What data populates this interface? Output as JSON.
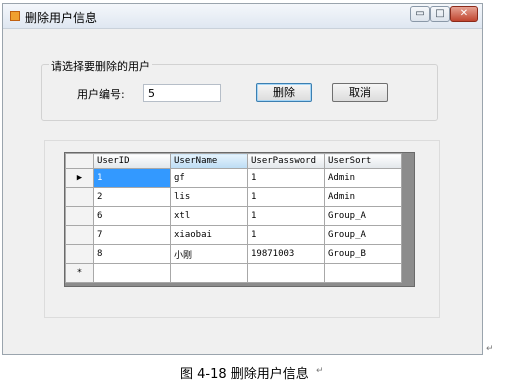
{
  "window": {
    "title": "删除用户信息",
    "controls": {
      "minimize": "▭",
      "maximize": "□",
      "close": "✕"
    }
  },
  "form": {
    "group_caption": "请选择要删除的用户",
    "id_label": "用户编号:",
    "id_value": "5",
    "delete_label": "删除",
    "cancel_label": "取消"
  },
  "grid": {
    "columns": [
      "UserID",
      "UserName",
      "UserPassword",
      "UserSort"
    ],
    "rows": [
      [
        "1",
        "gf",
        "1",
        "Admin"
      ],
      [
        "2",
        "lis",
        "1",
        "Admin"
      ],
      [
        "6",
        "xtl",
        "1",
        "Group_A"
      ],
      [
        "7",
        "xiaobai",
        "1",
        "Group_A"
      ],
      [
        "8",
        "小刚",
        "19871003",
        "Group_B"
      ]
    ],
    "current_row_marker": "▶",
    "new_row_marker": "*"
  },
  "caption": "图 4-18 删除用户信息",
  "paragraph_mark": "↵"
}
